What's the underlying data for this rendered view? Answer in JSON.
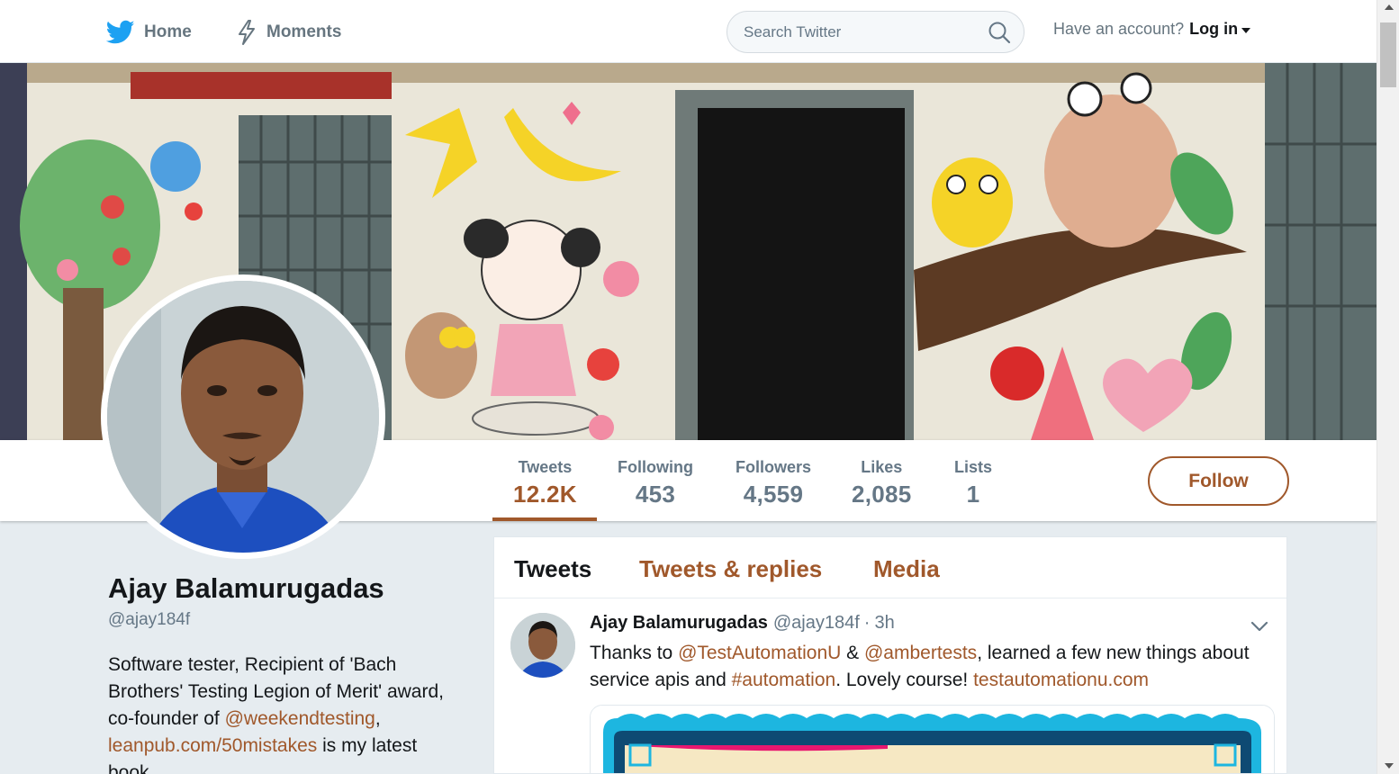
{
  "nav": {
    "home_label": "Home",
    "moments_label": "Moments",
    "search_placeholder": "Search Twitter",
    "account_prompt": "Have an account?",
    "login_label": "Log in"
  },
  "profile": {
    "name": "Ajay Balamurugadas",
    "handle": "@ajay184f",
    "bio": {
      "part1": "Software tester, Recipient of 'Bach Brothers' Testing Legion of Merit' award, co-founder of ",
      "mention": "@weekendtesting",
      "part2": ", ",
      "link": "leanpub.com/50mistakes",
      "part3": " is my latest book."
    },
    "follow_label": "Follow"
  },
  "stats": [
    {
      "label": "Tweets",
      "value": "12.2K"
    },
    {
      "label": "Following",
      "value": "453"
    },
    {
      "label": "Followers",
      "value": "4,559"
    },
    {
      "label": "Likes",
      "value": "2,085"
    },
    {
      "label": "Lists",
      "value": "1"
    }
  ],
  "timeline": {
    "tabs": [
      "Tweets",
      "Tweets & replies",
      "Media"
    ]
  },
  "tweet": {
    "author": "Ajay Balamurugadas",
    "handle": "@ajay184f",
    "separator": "·",
    "time": "3h",
    "text1": "Thanks to ",
    "mention1": "@TestAutomationU",
    "text2": " & ",
    "mention2": "@ambertests",
    "text3": ", learned a few new things about service apis and ",
    "hashtag": "#automation",
    "text4": ". Lovely course! ",
    "link": "testautomationu.com"
  },
  "colors": {
    "accent": "#a0582b",
    "twitter_blue": "#1da1f2",
    "background": "#e6ecf0"
  }
}
